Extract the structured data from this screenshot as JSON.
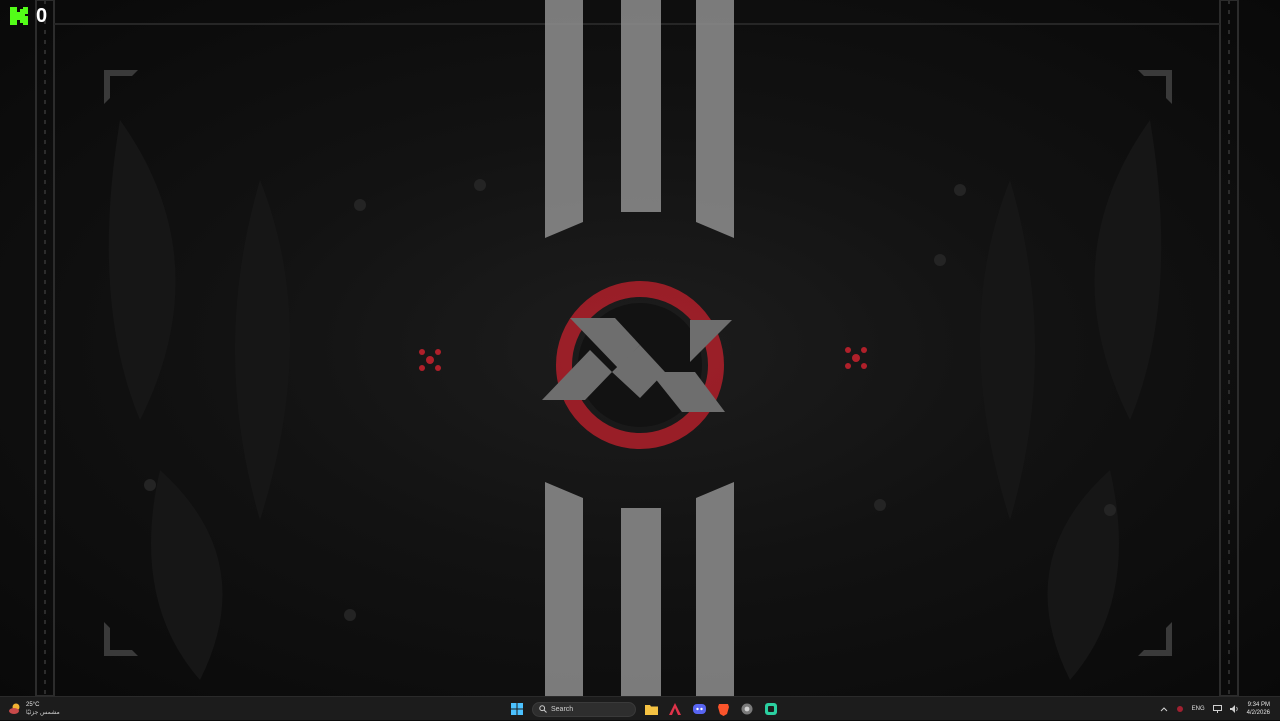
{
  "kick_widget": {
    "count": "0",
    "accent": "#53fc18"
  },
  "wallpaper": {
    "accent_red": "#b0202a",
    "stripe_color": "#8f8f8f"
  },
  "taskbar": {
    "weather": {
      "temperature": "25°C",
      "condition": "مشمس جزئيًا",
      "icon": "sun-cloud-icon"
    },
    "search": {
      "placeholder": "Search"
    },
    "pinned_apps": [
      {
        "name": "start-button",
        "icon": "windows-logo-icon"
      },
      {
        "name": "file-explorer",
        "icon": "folder-icon"
      },
      {
        "name": "app-a",
        "icon": "a-logo-icon"
      },
      {
        "name": "discord",
        "icon": "discord-icon"
      },
      {
        "name": "brave",
        "icon": "brave-icon"
      },
      {
        "name": "chrome-like",
        "icon": "browser-icon"
      },
      {
        "name": "app-green",
        "icon": "green-app-icon"
      }
    ],
    "tray": {
      "language": "ENG",
      "time": "9:34 PM",
      "date": "4/2/2026"
    }
  }
}
